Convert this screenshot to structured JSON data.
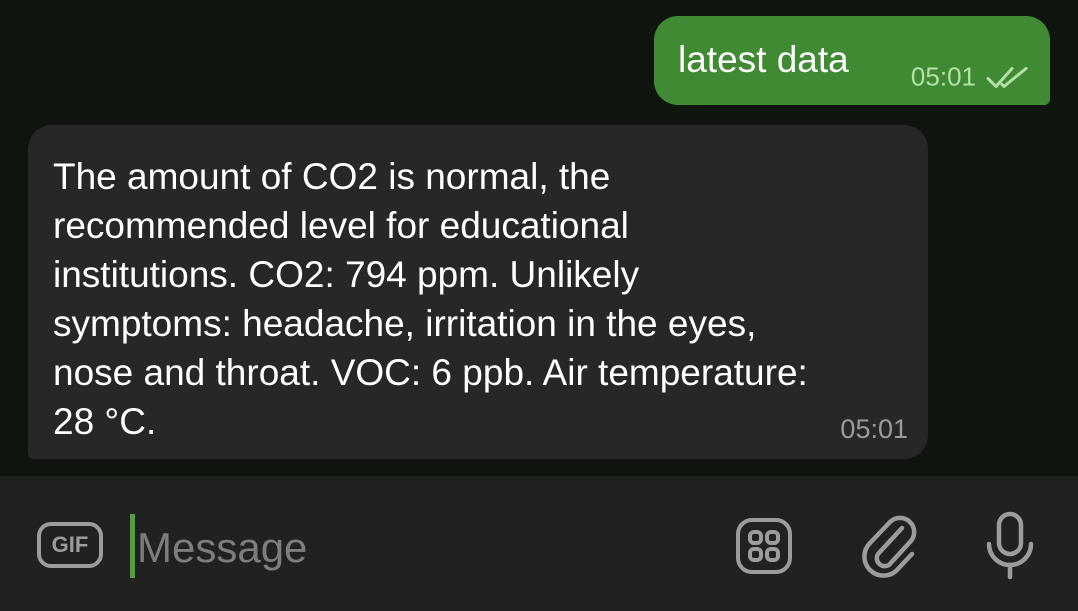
{
  "conversation": {
    "outgoing": {
      "text": "latest data",
      "time": "05:01",
      "status_icon": "double-check-icon"
    },
    "incoming": {
      "lines": [
        "The amount of CO2 is normal, the",
        "recommended level for educational",
        "institutions. CO2: 794 ppm. Unlikely",
        "symptoms: headache, irritation in the eyes,",
        "nose and throat. VOC: 6 ppb. Air temperature:",
        "28 °C."
      ],
      "time": "05:01"
    }
  },
  "input_bar": {
    "gif_label": "GIF",
    "placeholder": "Message",
    "icons": [
      "gif-icon",
      "sticker-icon",
      "attach-icon",
      "microphone-icon"
    ]
  },
  "colors": {
    "background": "#0f140f",
    "outgoing_bubble": "#3f8a33",
    "incoming_bubble": "#262826",
    "input_bar": "#212121",
    "accent": "#4aa43a"
  }
}
